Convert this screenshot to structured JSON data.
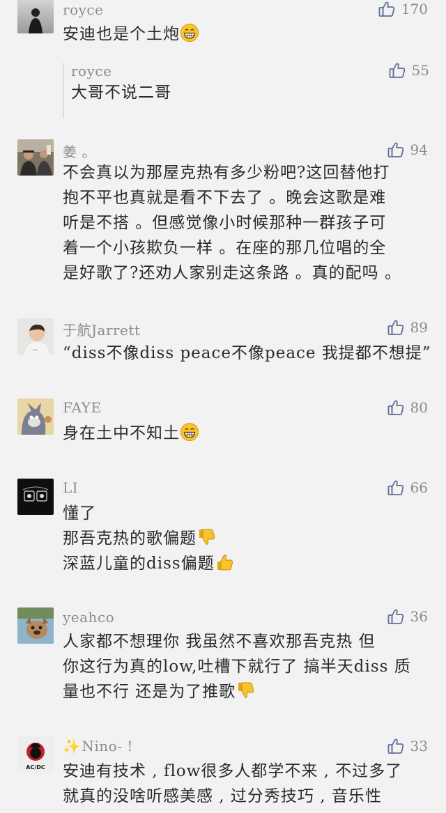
{
  "comments": [
    {
      "avatar": "avatar-royce",
      "name": "royce",
      "likes": "170",
      "lines": [
        "安迪也是个土炮"
      ],
      "line_emoji": [
        "grin-emoji"
      ],
      "reply": {
        "name": "royce",
        "likes": "55",
        "lines": [
          "大哥不说二哥"
        ]
      }
    },
    {
      "avatar": "avatar-jiang",
      "name": "姜 。",
      "likes": "94",
      "lines": [
        "不会真以为那屋克热有多少粉吧?这回替他打",
        "抱不平也真就是看不下去了 。晚会这歌是难",
        "听是不搭 。但感觉像小时候那种一群孩子可",
        "着一个小孩欺负一样 。在座的那几位唱的全",
        "是好歌了?还劝人家别走这条路 。真的配吗 。"
      ]
    },
    {
      "avatar": "avatar-yuhang",
      "name": "于航Jarrett",
      "likes": "89",
      "lines": [
        "“diss不像diss peace不像peace 我提都不想提”"
      ]
    },
    {
      "avatar": "avatar-faye",
      "name": "FAYE",
      "likes": "80",
      "lines": [
        "身在土中不知土"
      ],
      "line_emoji": [
        "grin-emoji"
      ]
    },
    {
      "avatar": "avatar-li",
      "name": "LI",
      "likes": "66",
      "lines": [
        "懂了",
        "那吾克热的歌偏题",
        "深蓝儿童的diss偏题"
      ],
      "line_emoji": [
        "",
        "thumbs-down-emoji",
        "thumbs-up-emoji"
      ]
    },
    {
      "avatar": "avatar-yeahco",
      "name": "yeahco",
      "likes": "36",
      "lines": [
        "人家都不想理你   我虽然不喜欢那吾克热 但",
        "你这行为真的low,吐槽下就行了 搞半天diss 质",
        "量也不行 还是为了推歌"
      ],
      "line_emoji": [
        "",
        "",
        "thumbs-down-emoji"
      ]
    },
    {
      "avatar": "avatar-nino",
      "name": "Nino- !",
      "name_prefix": "✨",
      "likes": "33",
      "lines": [
        "安迪有技术 , flow很多人都学不来 , 不过多了",
        "就真的没啥听感美感 , 过分秀技巧 , 音乐性"
      ],
      "avatar_text": "AC/DC"
    }
  ],
  "colors": {
    "background": "#f2f2f2",
    "meta_gray": "#8d8d8d",
    "text": "#2a2a2a",
    "like_icon": "#5d6f9a"
  }
}
